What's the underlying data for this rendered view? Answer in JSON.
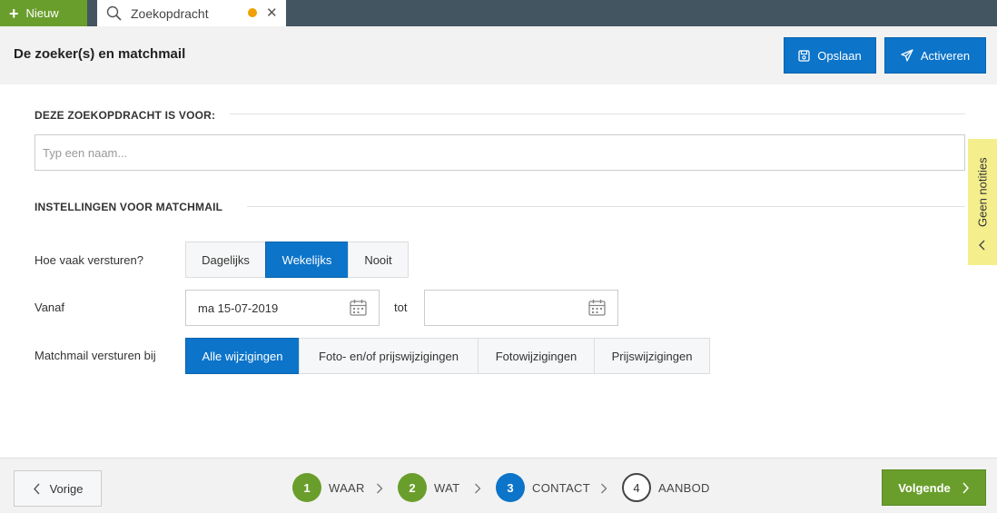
{
  "topbar": {
    "new_label": "Nieuw",
    "tab_title": "Zoekopdracht"
  },
  "header": {
    "title": "De zoeker(s) en matchmail",
    "save_label": "Opslaan",
    "activate_label": "Activeren"
  },
  "section_for": {
    "heading": "DEZE ZOEKOPDRACHT IS VOOR:",
    "name_placeholder": "Typ een naam...",
    "name_value": ""
  },
  "section_matchmail": {
    "heading": "INSTELLINGEN VOOR MATCHMAIL",
    "frequency_label": "Hoe vaak versturen?",
    "frequency_options": [
      "Dagelijks",
      "Wekelijks",
      "Nooit"
    ],
    "frequency_selected": "Wekelijks",
    "from_label": "Vanaf",
    "from_value": "ma 15-07-2019",
    "to_label": "tot",
    "to_value": "",
    "trigger_label": "Matchmail versturen bij",
    "trigger_options": [
      "Alle wijzigingen",
      "Foto- en/of prijswijzigingen",
      "Fotowijzigingen",
      "Prijswijzigingen"
    ],
    "trigger_selected": "Alle wijzigingen"
  },
  "notes_tab": {
    "label": "Geen notities"
  },
  "footer": {
    "prev_label": "Vorige",
    "next_label": "Volgende",
    "steps": [
      {
        "num": "1",
        "label": "WAAR",
        "state": "done"
      },
      {
        "num": "2",
        "label": "WAT",
        "state": "done"
      },
      {
        "num": "3",
        "label": "CONTACT",
        "state": "current"
      },
      {
        "num": "4",
        "label": "AANBOD",
        "state": "todo"
      }
    ]
  },
  "colors": {
    "primary_blue": "#0c74c9",
    "accent_green": "#6a9e2c",
    "topbar_dark": "#435560",
    "unsaved_dot": "#f0a000",
    "notes_yellow": "#f4ef8c"
  }
}
